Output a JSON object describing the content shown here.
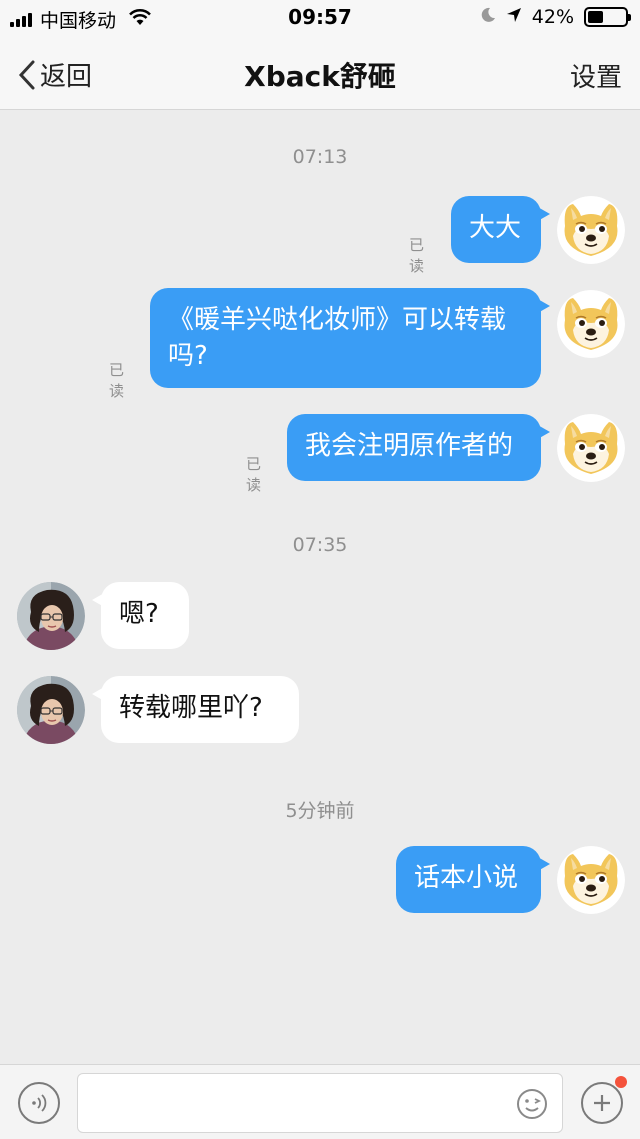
{
  "status_bar": {
    "carrier": "中国移动",
    "time": "09:57",
    "battery_percent": "42%",
    "battery_level": 0.42,
    "icons": [
      "signal-icon",
      "wifi-icon",
      "moon-icon",
      "location-arrow-icon",
      "battery-icon"
    ]
  },
  "nav": {
    "back_label": "返回",
    "title": "Xback舒砸",
    "settings_label": "设置"
  },
  "time_labels": [
    "07:13",
    "07:35",
    "5分钟前"
  ],
  "messages": [
    {
      "direction": "out",
      "lines": [
        "大大"
      ],
      "read": "已读"
    },
    {
      "direction": "out",
      "lines": [
        "《暖羊兴哒化妆师》可以转载",
        "吗?"
      ],
      "read": "已读"
    },
    {
      "direction": "out",
      "lines": [
        "我会注明原作者的"
      ],
      "read": "已读"
    },
    {
      "direction": "in",
      "lines": [
        "嗯?"
      ]
    },
    {
      "direction": "in",
      "lines": [
        "转载哪里吖?"
      ]
    },
    {
      "direction": "out",
      "lines": [
        "话本小说"
      ],
      "read": ""
    }
  ],
  "input": {
    "placeholder": "",
    "icons": [
      "voice-icon",
      "emoji-icon",
      "plus-icon"
    ]
  },
  "colors": {
    "outgoing_bubble": "#3a9df5",
    "incoming_bubble": "#ffffff",
    "background": "#ececec",
    "notification_dot": "#f4523b"
  }
}
